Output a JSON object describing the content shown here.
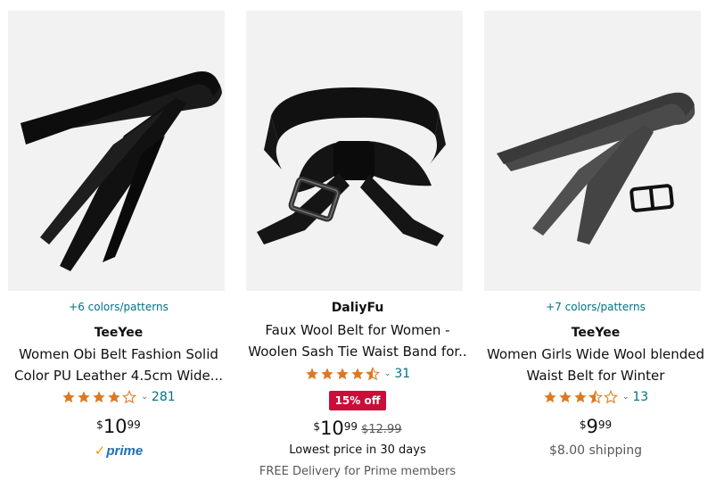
{
  "products": [
    {
      "colors": "+6 colors/patterns",
      "brand": "TeeYee",
      "title_line1": "Women Obi Belt Fashion Solid",
      "title_line2": "Color PU Leather 4.5cm Wide...",
      "stars": 4.0,
      "review_count": "281",
      "price_symbol": "$",
      "price_whole": "10",
      "price_fraction": "99",
      "prime": "prime",
      "image": "black-pu-leather-obi-belt"
    },
    {
      "brand": "DaliyFu",
      "title_line1": "Faux Wool Belt for Women -",
      "title_line2": "Woolen Sash Tie Waist Band for..",
      "stars": 4.5,
      "review_count": "31",
      "badge": "15% off",
      "price_symbol": "$",
      "price_whole": "10",
      "price_fraction": "99",
      "list_price": "$12.99",
      "lowest_price_note": "Lowest price in 30 days",
      "delivery": "FREE Delivery for Prime members",
      "image": "black-wool-sash-belt-with-buckle"
    },
    {
      "colors": "+7 colors/patterns",
      "brand": "TeeYee",
      "title_line1": "Women Girls Wide Wool blended",
      "title_line2": "Waist Belt for Winter",
      "stars": 3.5,
      "review_count": "13",
      "price_symbol": "$",
      "price_whole": "9",
      "price_fraction": "99",
      "shipping": "$8.00 shipping",
      "image": "grey-wool-belt-with-slider-buckle"
    }
  ],
  "colors_theme": {
    "star": "#de7921",
    "link": "#007185",
    "badge": "#cc0c39",
    "prime_check": "#ff9900",
    "prime_word": "#1f6fb4"
  }
}
